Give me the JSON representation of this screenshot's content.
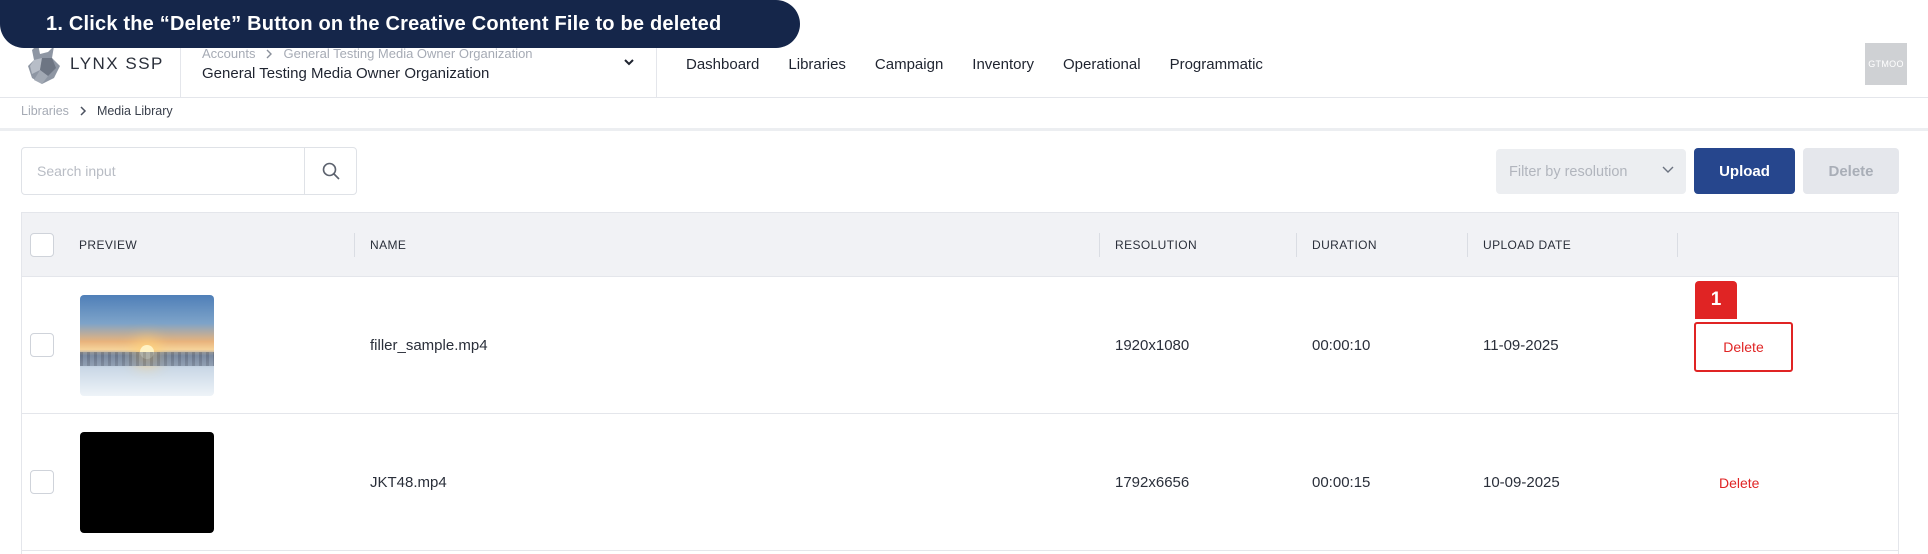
{
  "callout": {
    "text": "1. Click the “Delete” Button on the Creative Content File to be deleted"
  },
  "brand": {
    "name": "LYNX SSP",
    "logo_icon": "lynx-logo-icon"
  },
  "org": {
    "crumbs": [
      "Accounts",
      "General Testing Media Owner Organization"
    ],
    "name": "General Testing Media Owner Organization"
  },
  "nav": {
    "items": [
      "Dashboard",
      "Libraries",
      "Campaign",
      "Inventory",
      "Operational",
      "Programmatic"
    ]
  },
  "avatar": {
    "initials": "GTMOO"
  },
  "breadcrumb": {
    "parent": "Libraries",
    "current": "Media Library"
  },
  "search": {
    "placeholder": "Search input",
    "value": ""
  },
  "filter": {
    "placeholder": "Filter by resolution"
  },
  "toolbar": {
    "upload_label": "Upload",
    "delete_label": "Delete"
  },
  "table": {
    "columns": [
      "PREVIEW",
      "NAME",
      "RESOLUTION",
      "DURATION",
      "UPLOAD DATE"
    ],
    "rows": [
      {
        "name": "filler_sample.mp4",
        "resolution": "1920x1080",
        "duration": "00:00:10",
        "upload_date": "11-09-2025",
        "action": "Delete",
        "preview": "winter-sunset-thumbnail"
      },
      {
        "name": "JKT48.mp4",
        "resolution": "1792x6656",
        "duration": "00:00:15",
        "upload_date": "10-09-2025",
        "action": "Delete",
        "preview": "black-thumbnail"
      }
    ]
  },
  "step_badge": "1",
  "colors": {
    "primary": "#26468d",
    "danger": "#e02424",
    "callout_bg": "#15264a"
  }
}
